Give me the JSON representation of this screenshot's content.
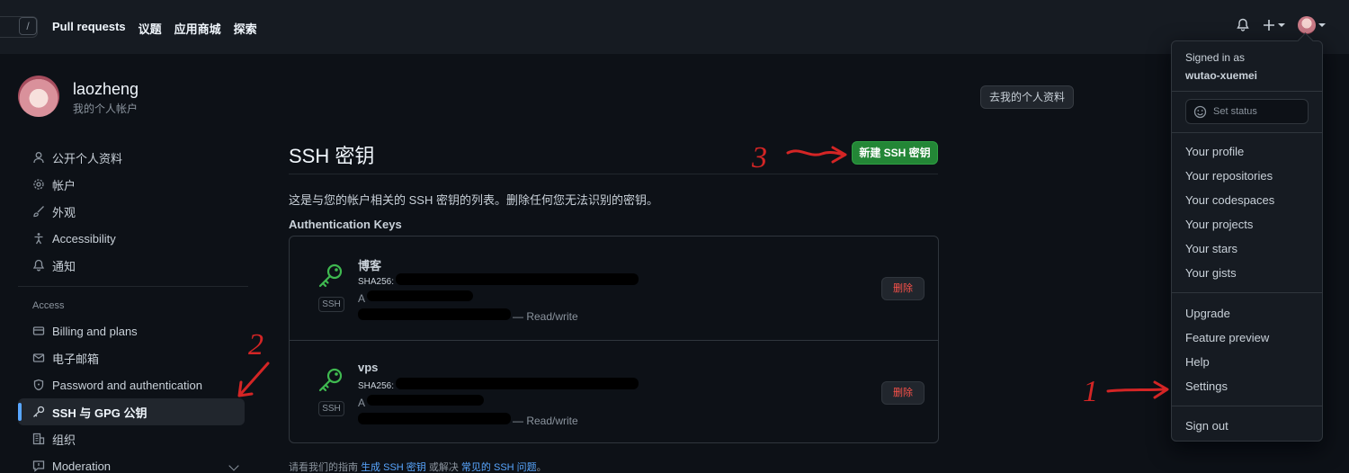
{
  "header": {
    "slash_key": "/",
    "nav": [
      "Pull requests",
      "议题",
      "应用商城",
      "探索"
    ]
  },
  "profile": {
    "name": "laozheng",
    "subtitle": "我的个人帐户",
    "goto_button": "去我的个人资料"
  },
  "sidebar": {
    "items": [
      {
        "label": "公开个人资料",
        "icon": "person-icon"
      },
      {
        "label": "帐户",
        "icon": "gear-icon"
      },
      {
        "label": "外观",
        "icon": "paintbrush-icon"
      },
      {
        "label": "Accessibility",
        "icon": "accessibility-icon"
      },
      {
        "label": "通知",
        "icon": "bell-icon"
      }
    ],
    "access_group": "Access",
    "access_items": [
      {
        "label": "Billing and plans",
        "icon": "credit-card-icon"
      },
      {
        "label": "电子邮箱",
        "icon": "mail-icon"
      },
      {
        "label": "Password and authentication",
        "icon": "shield-icon"
      },
      {
        "label": "SSH 与 GPG 公钥",
        "icon": "key-icon",
        "active": true
      },
      {
        "label": "组织",
        "icon": "organization-icon"
      },
      {
        "label": "Moderation",
        "icon": "report-icon"
      }
    ]
  },
  "main": {
    "title": "SSH 密钥",
    "new_button": "新建 SSH 密钥",
    "description": "这是与您的帐户相关的 SSH 密钥的列表。删除任何您无法识别的密钥。",
    "section_heading": "Authentication Keys",
    "keys": [
      {
        "name": "博客",
        "fingerprint": "SHA256:",
        "added": "A",
        "access": "— Read/write",
        "tag": "SSH",
        "delete": "删除"
      },
      {
        "name": "vps",
        "fingerprint": "SHA256:",
        "added": "A",
        "access": "— Read/write",
        "tag": "SSH",
        "delete": "删除"
      }
    ],
    "guide": {
      "prefix": "请看我们的指南 ",
      "link1": "生成 SSH 密钥",
      "middle": " 或解决 ",
      "link2": "常见的 SSH 问题",
      "suffix": "。"
    }
  },
  "dropdown": {
    "signed_in_as": "Signed in as",
    "username": "wutao-xuemei",
    "set_status": "Set status",
    "group1": [
      "Your profile",
      "Your repositories",
      "Your codespaces",
      "Your projects",
      "Your stars",
      "Your gists"
    ],
    "group2": [
      "Upgrade",
      "Feature preview",
      "Help",
      "Settings"
    ],
    "sign_out": "Sign out"
  },
  "annotations": [
    "1",
    "2",
    "3"
  ],
  "colors": {
    "background": "#0d1117",
    "header": "#161b22",
    "primary_button": "#238636",
    "danger": "#f85149",
    "link": "#58a6ff",
    "key_icon": "#3fb950",
    "annotation": "#d42525"
  }
}
